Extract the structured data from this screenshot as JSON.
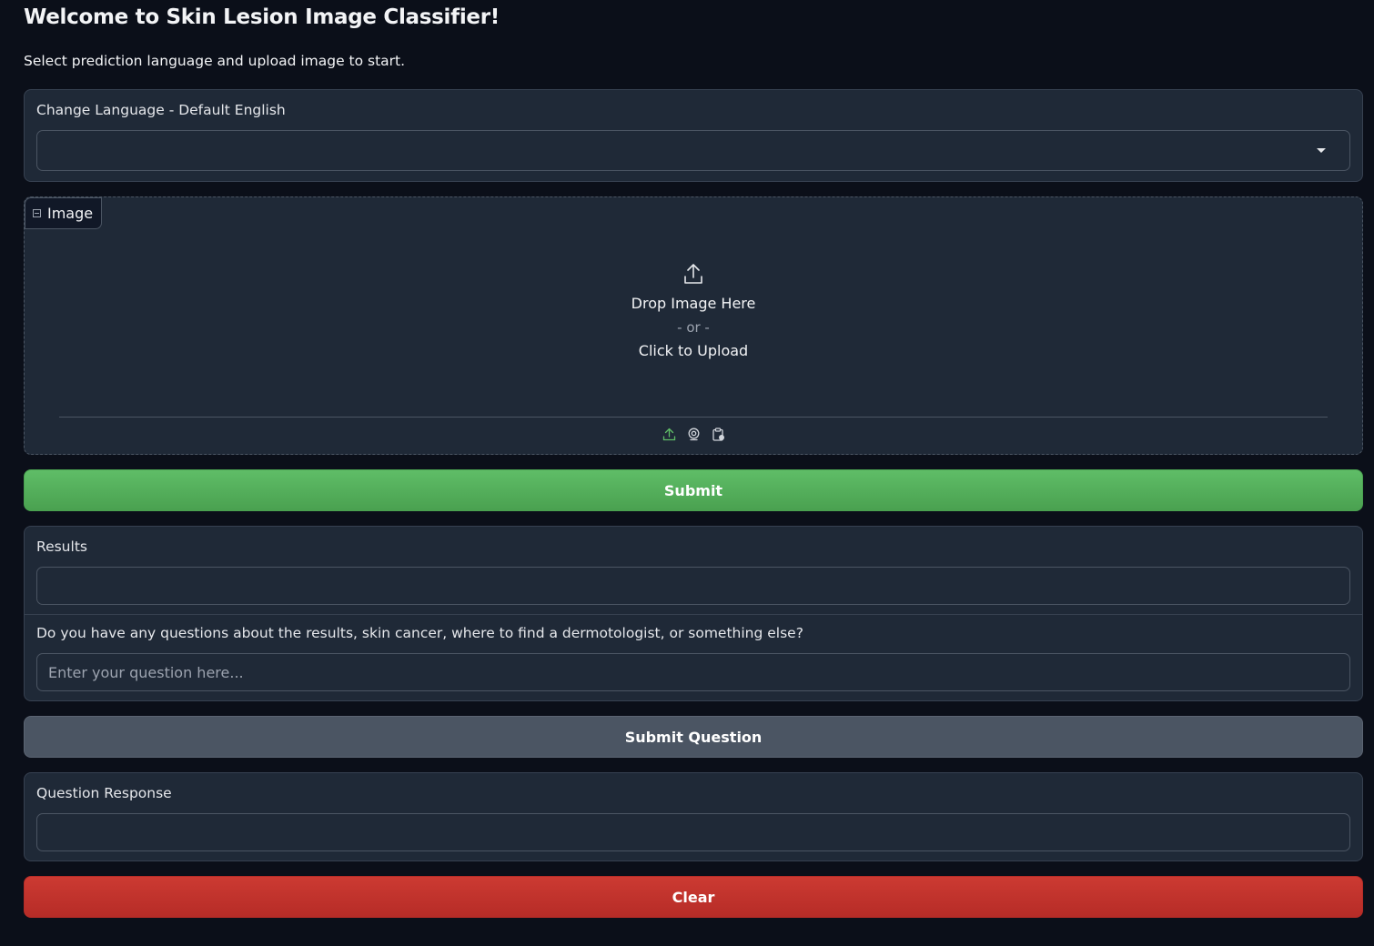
{
  "header": {
    "title": "Welcome to Skin Lesion Image Classifier!",
    "subtitle": "Select prediction language and upload image to start."
  },
  "language": {
    "label": "Change Language - Default English",
    "value": ""
  },
  "image_upload": {
    "tag_label": "Image",
    "drop_text": "Drop Image Here",
    "or_text": "- or -",
    "click_text": "Click to Upload",
    "sources": [
      "upload-icon",
      "webcam-icon",
      "clipboard-icon"
    ]
  },
  "buttons": {
    "submit": "Submit",
    "submit_question": "Submit Question",
    "clear": "Clear"
  },
  "results": {
    "label": "Results",
    "value": ""
  },
  "question": {
    "label": "Do you have any questions about the results, skin cancer, where to find a dermotologist, or something else?",
    "placeholder": "Enter your question here..."
  },
  "response": {
    "label": "Question Response",
    "value": ""
  },
  "colors": {
    "background": "#0b0f19",
    "panel": "#1f2937",
    "submit": "#5fbd67",
    "secondary": "#4b5563",
    "clear": "#cc3a32"
  }
}
